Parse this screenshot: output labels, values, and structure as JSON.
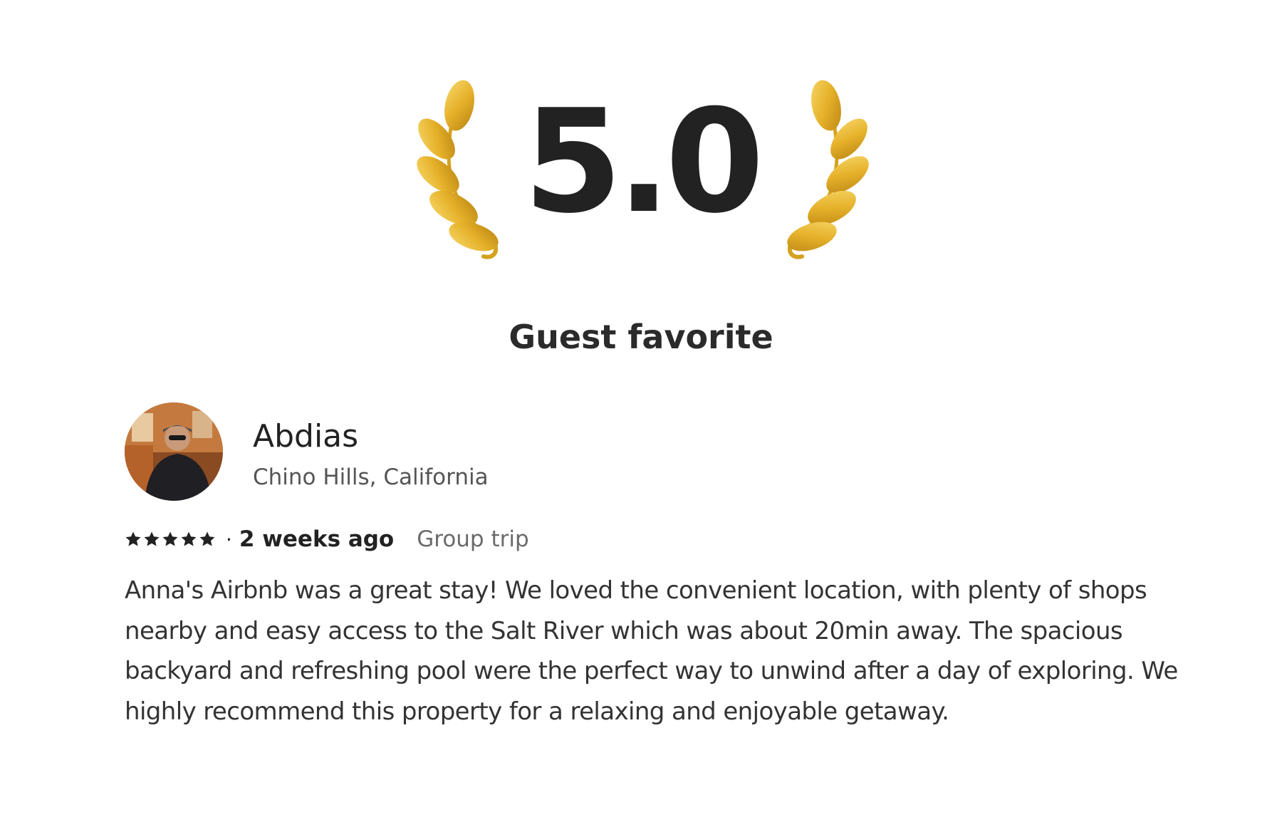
{
  "rating": {
    "value": "5.0",
    "badge": "Guest favorite",
    "accent_gold": "#E8B824",
    "icon": "laurel-icon"
  },
  "review": {
    "reviewer_name": "Abdias",
    "reviewer_location": "Chino Hills, California",
    "star_count": 5,
    "date": "2 weeks ago",
    "trip_type": "Group trip",
    "text": "Anna's Airbnb was a great stay! We loved the convenient location, with plenty of shops nearby and easy access to the Salt River which was about 20min away. The spacious backyard and refreshing pool were the perfect way to unwind after a day of exploring. We highly recommend this property for a relaxing and enjoyable getaway."
  }
}
